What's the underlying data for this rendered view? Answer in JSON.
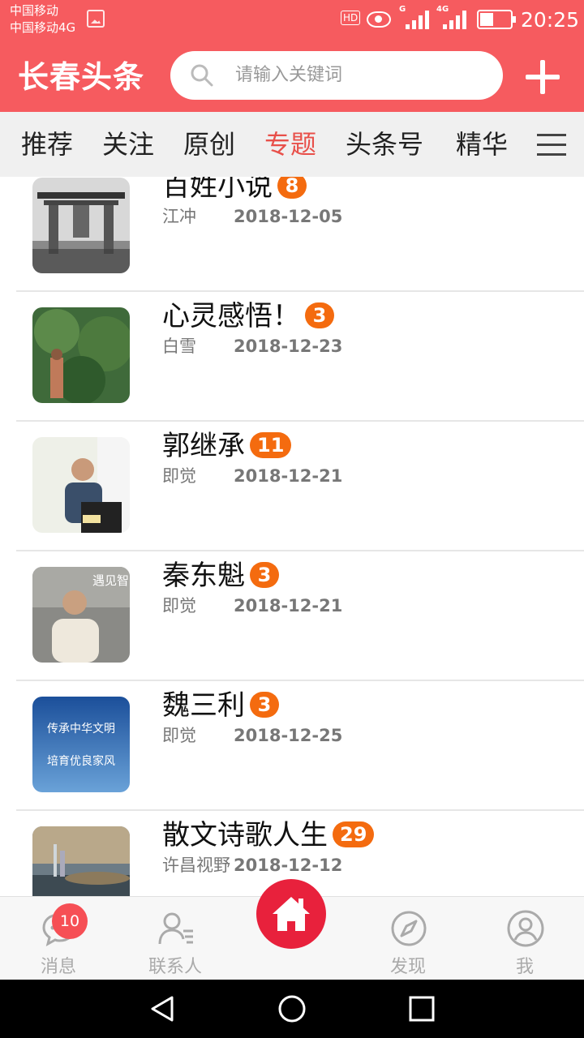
{
  "status_bar": {
    "carrier_line1": "中国移动",
    "carrier_line2": "中国移动4G",
    "hd_label": "HD",
    "net1": "G",
    "net2": "4G",
    "time": "20:25"
  },
  "header": {
    "title": "长春头条",
    "search_placeholder": "请输入关键词"
  },
  "tabs": [
    {
      "label": "推荐",
      "active": false
    },
    {
      "label": "关注",
      "active": false
    },
    {
      "label": "原创",
      "active": false
    },
    {
      "label": "专题",
      "active": true
    },
    {
      "label": "头条号",
      "active": false
    },
    {
      "label": "精华",
      "active": false
    }
  ],
  "topics": [
    {
      "title": "百姓小说",
      "count": "8",
      "author": "江冲",
      "date": "2018-12-05"
    },
    {
      "title": "心灵感悟！",
      "count": "3",
      "author": "白雪",
      "date": "2018-12-23"
    },
    {
      "title": "郭继承",
      "count": "11",
      "author": "即觉",
      "date": "2018-12-21"
    },
    {
      "title": "秦东魁",
      "count": "3",
      "author": "即觉",
      "date": "2018-12-21"
    },
    {
      "title": "魏三利",
      "count": "3",
      "author": "即觉",
      "date": "2018-12-25"
    },
    {
      "title": "散文诗歌人生",
      "count": "29",
      "author": "许昌视野",
      "date": "2018-12-12"
    }
  ],
  "thumb_texts": {
    "t4": "遇见智慧",
    "t5_line1": "传承中华文明",
    "t5_line2": "培育优良家风"
  },
  "bottom_nav": {
    "messages": "消息",
    "messages_badge": "10",
    "contacts": "联系人",
    "discover": "发现",
    "me": "我"
  },
  "colors": {
    "brand": "#f65b5f",
    "active_tab": "#e8504a",
    "badge": "#f46b0f",
    "home": "#e8213c"
  }
}
